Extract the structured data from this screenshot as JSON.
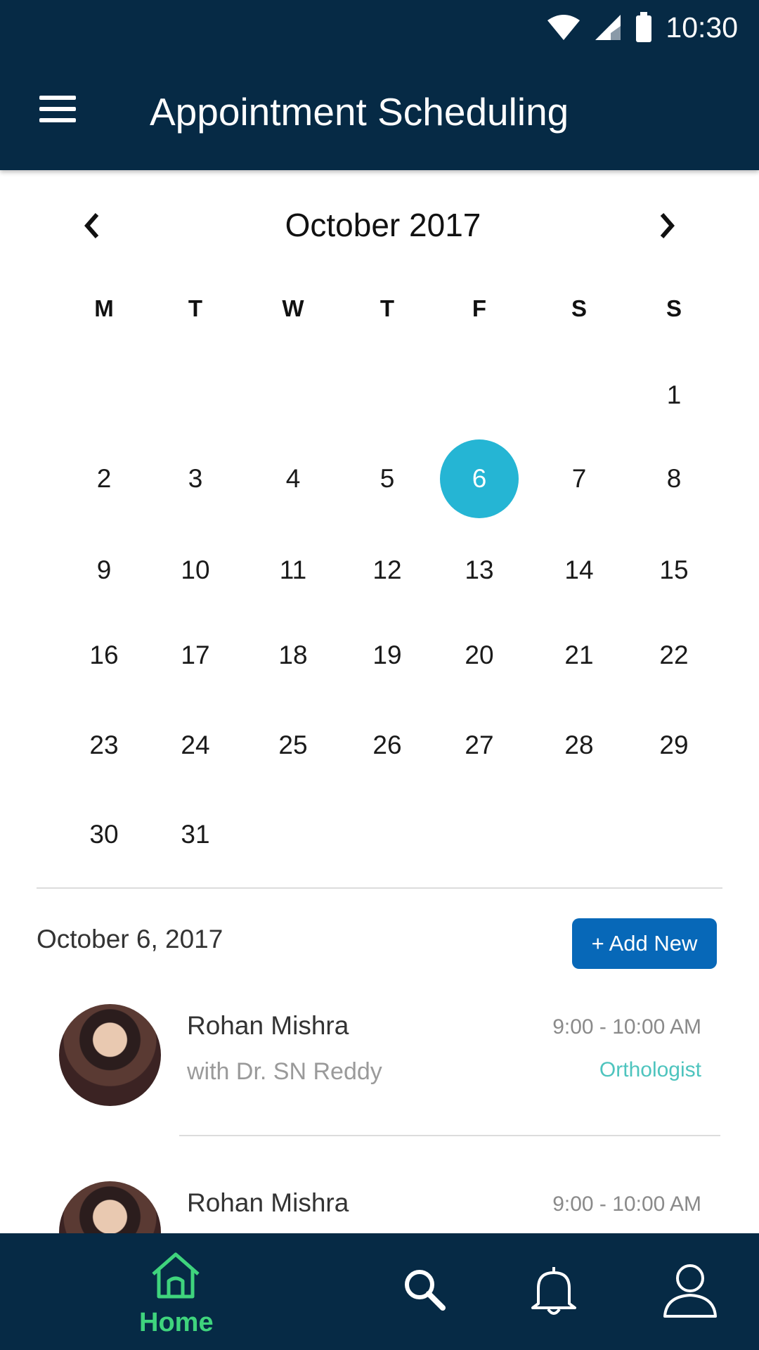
{
  "status_bar": {
    "time": "10:30",
    "icons": [
      "wifi-icon",
      "signal-icon",
      "battery-icon"
    ]
  },
  "app_bar": {
    "title": "Appointment Scheduling",
    "menu_icon": "menu-icon"
  },
  "calendar": {
    "month_label": "October 2017",
    "prev_icon": "chevron-left-icon",
    "next_icon": "chevron-right-icon",
    "weekdays": [
      "M",
      "T",
      "W",
      "T",
      "F",
      "S",
      "S"
    ],
    "weeks": [
      [
        "",
        "",
        "",
        "",
        "",
        "",
        "1"
      ],
      [
        "2",
        "3",
        "4",
        "5",
        "6",
        "7",
        "8"
      ],
      [
        "9",
        "10",
        "11",
        "12",
        "13",
        "14",
        "15"
      ],
      [
        "16",
        "17",
        "18",
        "19",
        "20",
        "21",
        "22"
      ],
      [
        "23",
        "24",
        "25",
        "26",
        "27",
        "28",
        "29"
      ],
      [
        "30",
        "31",
        "",
        "",
        "",
        "",
        ""
      ]
    ],
    "selected_day": "6",
    "selected_color": "#25b5d4"
  },
  "schedule": {
    "date_label": "October 6, 2017",
    "add_button": "+ Add New",
    "appointments": [
      {
        "name": "Rohan Mishra",
        "doctor": "with Dr. SN Reddy",
        "time": "9:00 - 10:00 AM",
        "specialty": "Orthologist"
      },
      {
        "name": "Rohan Mishra",
        "doctor": "",
        "time": "9:00 - 10:00 AM",
        "specialty": ""
      }
    ]
  },
  "bottom_nav": {
    "items": [
      {
        "icon": "home-icon",
        "label": "Home",
        "active": true
      },
      {
        "icon": "search-icon",
        "label": ""
      },
      {
        "icon": "bell-icon",
        "label": ""
      },
      {
        "icon": "profile-icon",
        "label": ""
      }
    ],
    "active_color": "#3fd47d"
  },
  "colors": {
    "primary_dark": "#062a45",
    "accent_button": "#0768b8",
    "specialty_text": "#4ec4be"
  }
}
